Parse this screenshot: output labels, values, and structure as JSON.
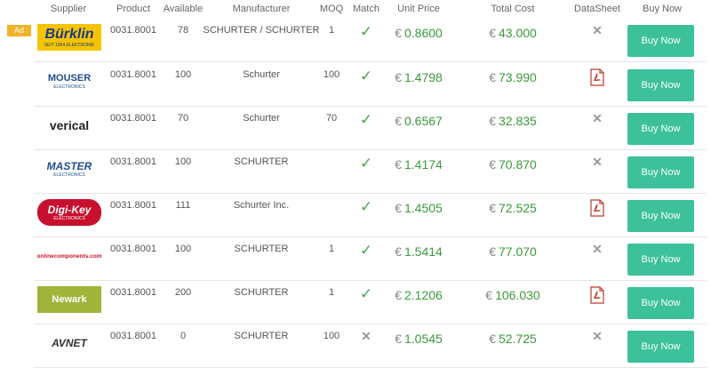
{
  "headers": {
    "supplier": "Supplier",
    "product": "Product",
    "available": "Available",
    "manufacturer": "Manufacturer",
    "moq": "MOQ",
    "match": "Match",
    "unit_price": "Unit Price",
    "total_cost": "Total Cost",
    "datasheet": "DataSheet",
    "buy_now": "Buy Now"
  },
  "ad_label": "Ad",
  "currency": "€",
  "buy_label": "Buy Now",
  "colors": {
    "buy_button": "#3cc19b",
    "price": "#3a9a3a",
    "ad_badge": "#f0b429"
  },
  "rows": [
    {
      "supplier_logo": "Bürklin",
      "supplier_tagline": "SEIT 1954 ELEKTRONIK",
      "product": "0031.8001",
      "available": "78",
      "manufacturer": "SCHURTER / SCHURTER",
      "moq": "1",
      "match": "check-icon",
      "unit_price": "0.8600",
      "total_cost": "43.000",
      "datasheet": "none-icon"
    },
    {
      "supplier_logo": "MOUSER",
      "supplier_tagline": "ELECTRONICS",
      "product": "0031.8001",
      "available": "100",
      "manufacturer": "Schurter",
      "moq": "100",
      "match": "check-icon",
      "unit_price": "1.4798",
      "total_cost": "73.990",
      "datasheet": "pdf-icon"
    },
    {
      "supplier_logo": "verical",
      "supplier_tagline": "",
      "product": "0031.8001",
      "available": "70",
      "manufacturer": "Schurter",
      "moq": "70",
      "match": "check-icon",
      "unit_price": "0.6567",
      "total_cost": "32.835",
      "datasheet": "none-icon"
    },
    {
      "supplier_logo": "MASTER",
      "supplier_tagline": "ELECTRONICS",
      "product": "0031.8001",
      "available": "100",
      "manufacturer": "SCHURTER",
      "moq": "",
      "match": "check-icon",
      "unit_price": "1.4174",
      "total_cost": "70.870",
      "datasheet": "none-icon"
    },
    {
      "supplier_logo": "Digi-Key",
      "supplier_tagline": "ELECTRONICS",
      "product": "0031.8001",
      "available": "111",
      "manufacturer": "Schurter Inc.",
      "moq": "",
      "match": "check-icon",
      "unit_price": "1.4505",
      "total_cost": "72.525",
      "datasheet": "pdf-icon"
    },
    {
      "supplier_logo": "onlinecomponents.com",
      "supplier_tagline": "",
      "product": "0031.8001",
      "available": "100",
      "manufacturer": "SCHURTER",
      "moq": "1",
      "match": "check-icon",
      "unit_price": "1.5414",
      "total_cost": "77.070",
      "datasheet": "none-icon"
    },
    {
      "supplier_logo": "Newark",
      "supplier_tagline": "",
      "product": "0031.8001",
      "available": "200",
      "manufacturer": "SCHURTER",
      "moq": "1",
      "match": "check-icon",
      "unit_price": "2.1206",
      "total_cost": "106.030",
      "datasheet": "pdf-icon"
    },
    {
      "supplier_logo": "AVNET",
      "supplier_tagline": "",
      "product": "0031.8001",
      "available": "0",
      "manufacturer": "SCHURTER",
      "moq": "100",
      "match": "cross-icon",
      "unit_price": "1.0545",
      "total_cost": "52.725",
      "datasheet": "none-icon"
    }
  ]
}
